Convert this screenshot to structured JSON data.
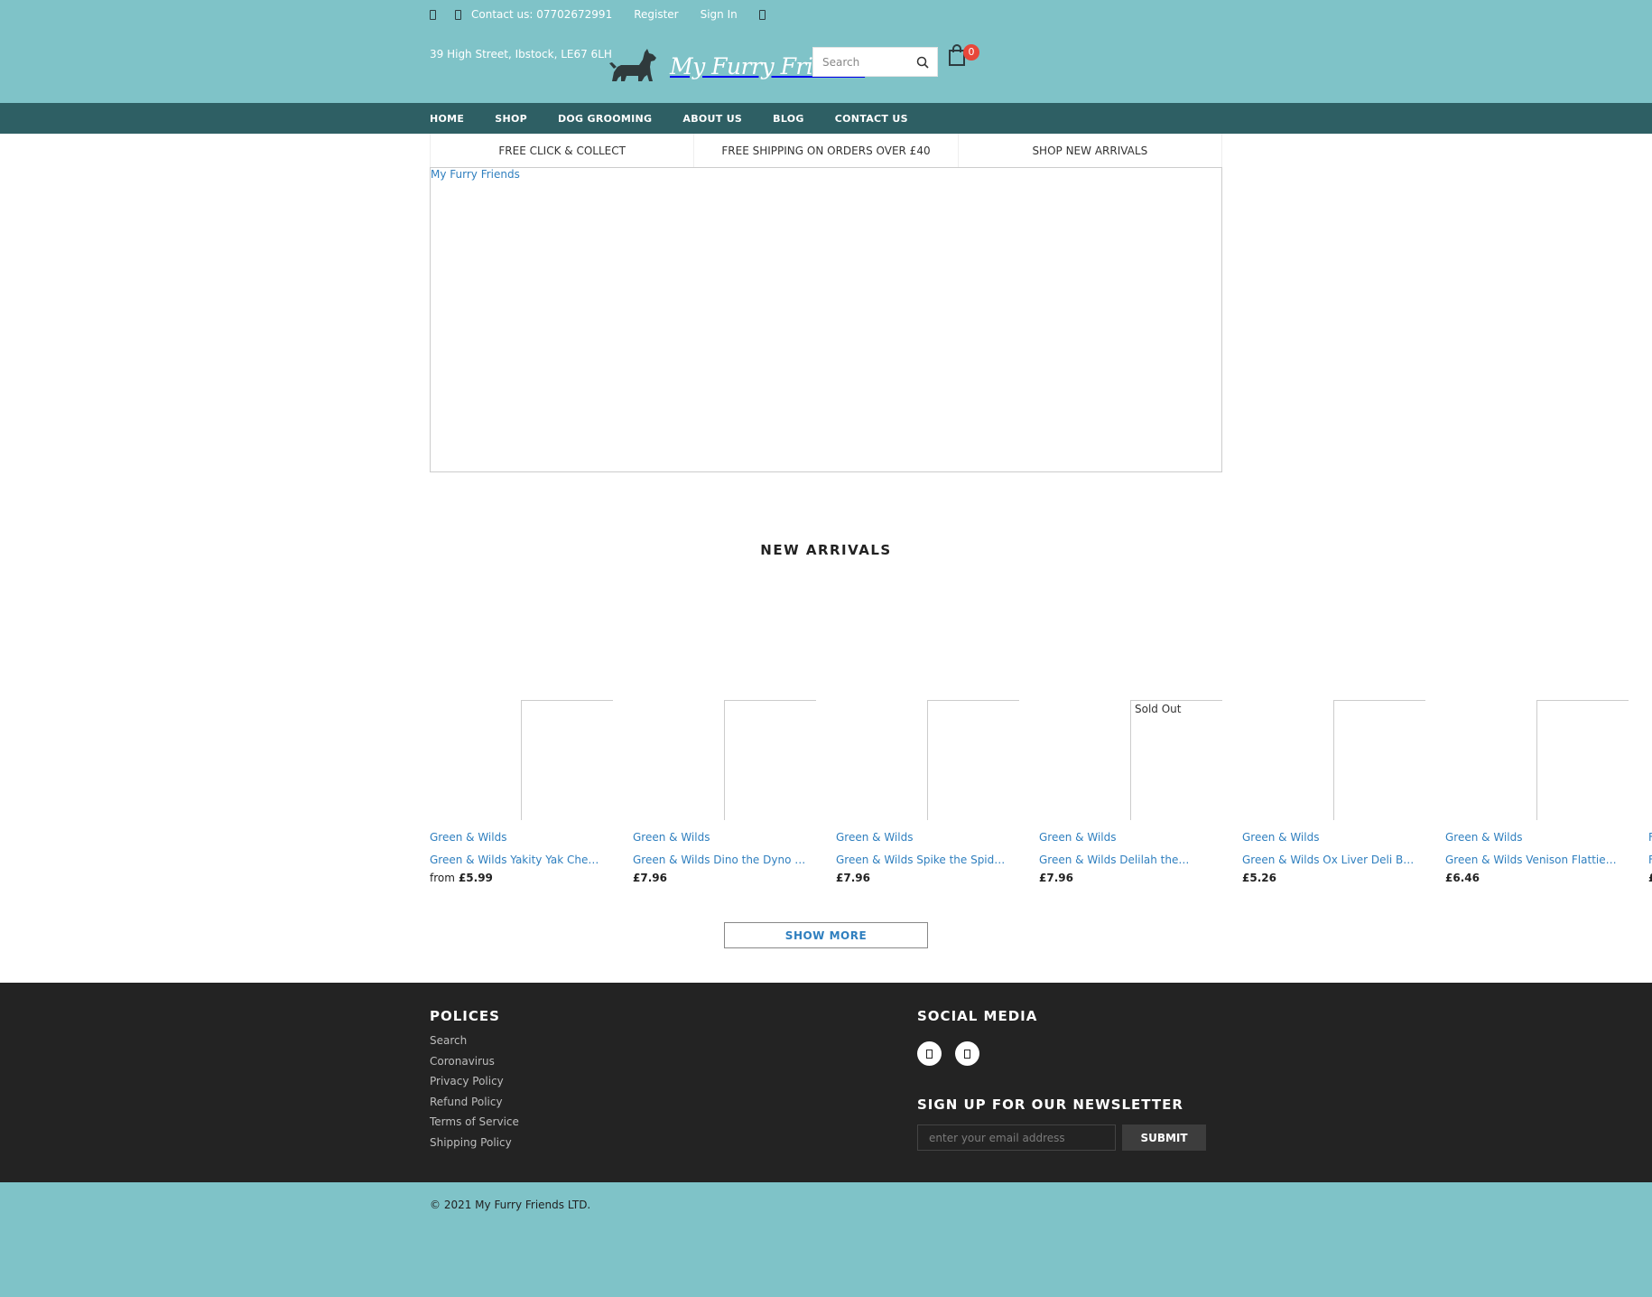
{
  "topbar": {
    "contact": "Contact us: 07702672991",
    "register": "Register",
    "sign_in": "Sign In",
    "address": "39 High Street, Ibstock, LE67 6LH",
    "icons": [
      "location-icon",
      "phone-icon",
      "wishlist-icon"
    ]
  },
  "logo": {
    "text": "My Furry Friends",
    "icon": "scottie-dog-icon"
  },
  "search": {
    "placeholder": "Search",
    "icon": "search-icon"
  },
  "cart": {
    "count": "0",
    "icon": "shopping-bag-icon"
  },
  "nav": {
    "items": [
      "HOME",
      "SHOP",
      "DOG GROOMING",
      "ABOUT US",
      "BLOG",
      "CONTACT US"
    ]
  },
  "usp": [
    "FREE CLICK & COLLECT",
    "FREE SHIPPING ON ORDERS OVER £40",
    "SHOP NEW ARRIVALS"
  ],
  "slideshow": {
    "link_text": "My Furry Friends"
  },
  "new_arrivals": {
    "title": "NEW ARRIVALS",
    "products": [
      {
        "vendor": "Green & Wilds",
        "title": "Green & Wilds Yakity Yak Chew…",
        "price_prefix": "from",
        "price": "£5.99",
        "sold_out": ""
      },
      {
        "vendor": "Green & Wilds",
        "title": "Green & Wilds Dino the Dyno Fish.",
        "price_prefix": "",
        "price": "£7.96",
        "sold_out": ""
      },
      {
        "vendor": "Green & Wilds",
        "title": "Green & Wilds Spike the Spider…",
        "price_prefix": "",
        "price": "£7.96",
        "sold_out": ""
      },
      {
        "vendor": "Green & Wilds",
        "title": "Green & Wilds Delilah the…",
        "price_prefix": "",
        "price": "£7.96",
        "sold_out": "Sold Out"
      },
      {
        "vendor": "Green & Wilds",
        "title": "Green & Wilds Ox Liver Deli Bites…",
        "price_prefix": "",
        "price": "£5.26",
        "sold_out": ""
      },
      {
        "vendor": "Green & Wilds",
        "title": "Green & Wilds Venison Flatties,…",
        "price_prefix": "",
        "price": "£6.46",
        "sold_out": ""
      },
      {
        "vendor": "F",
        "title": "F",
        "price_prefix": "",
        "price": "£",
        "sold_out": ""
      }
    ],
    "show_more": "SHOW MORE"
  },
  "footer": {
    "policies_title": "POLICES",
    "policies": [
      "Search",
      "Coronavirus",
      "Privacy Policy",
      "Refund Policy",
      "Terms of Service",
      "Shipping Policy"
    ],
    "social_title": "SOCIAL MEDIA",
    "social_icons": [
      "facebook-icon",
      "instagram-icon"
    ],
    "newsletter_title": "SIGN UP FOR OUR NEWSLETTER",
    "newsletter_placeholder": "enter your email address",
    "submit": "SUBMIT"
  },
  "copyright": "© 2021 My Furry Friends LTD.",
  "colors": {
    "brand_teal": "#7fc3c8",
    "nav_dark": "#2e5f64",
    "footer": "#232323",
    "link": "#2f7fbf",
    "badge": "#e8473a"
  }
}
